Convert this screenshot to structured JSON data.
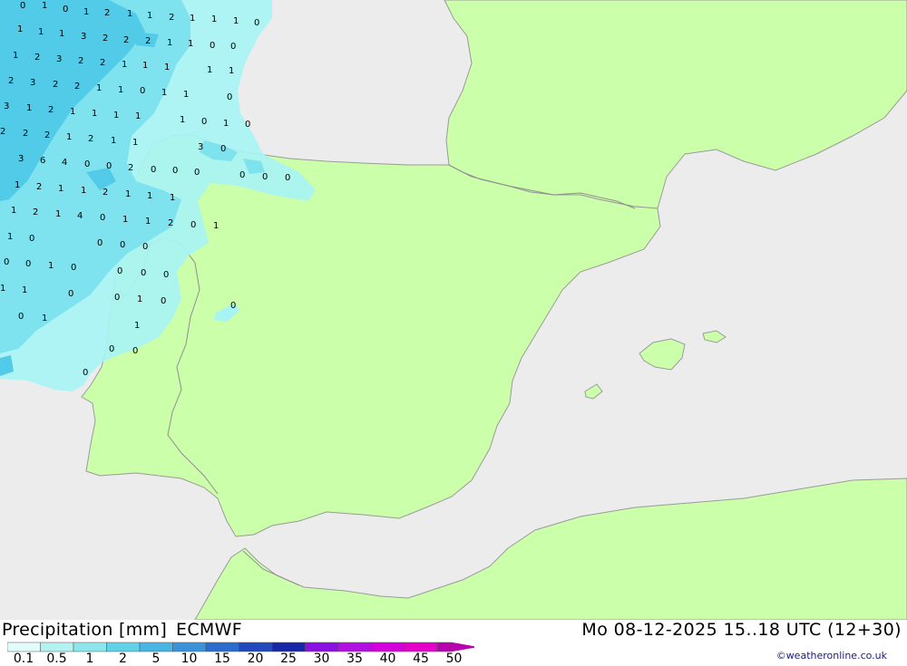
{
  "map": {
    "colors": {
      "sea": "#ececec",
      "land": "#ccffaa",
      "border": "#8f8f8f",
      "coast": "#9a9a9a"
    },
    "precip_colors": {
      "light": "#a8f4f4",
      "moderate": "#7ee3ef",
      "heavier": "#52cbe8"
    },
    "values": [
      "0",
      "1",
      "0",
      "1",
      "2",
      "1",
      "1",
      "2",
      "1",
      "1",
      "1",
      "0",
      "1",
      "1",
      "1",
      "3",
      "2",
      "2",
      "2",
      "1",
      "1",
      "0",
      "0",
      "1",
      "2",
      "3",
      "2",
      "2",
      "1",
      "1",
      "1",
      "1",
      "1",
      "2",
      "3",
      "2",
      "2",
      "1",
      "1",
      "0",
      "1",
      "1",
      "0",
      "3",
      "1",
      "2",
      "1",
      "1",
      "1",
      "1",
      "1",
      "0",
      "1",
      "0",
      "2",
      "2",
      "2",
      "1",
      "2",
      "1",
      "1",
      "3",
      "0",
      "3",
      "6",
      "4",
      "0",
      "0",
      "2",
      "0",
      "0",
      "0",
      "0",
      "0",
      "0",
      "1",
      "2",
      "1",
      "1",
      "2",
      "1",
      "1",
      "1",
      "1",
      "2",
      "1",
      "4",
      "0",
      "1",
      "1",
      "2",
      "0",
      "1",
      "1",
      "0",
      "0",
      "0",
      "0",
      "0",
      "0",
      "1",
      "0",
      "0",
      "0",
      "0",
      "1",
      "1",
      "0",
      "0",
      "1",
      "0",
      "0",
      "0",
      "1",
      "1",
      "0",
      "0",
      "0"
    ]
  },
  "footer": {
    "title": "Precipitation [mm]",
    "model": "ECMWF",
    "datetime": "Mo 08-12-2025 15..18 UTC (12+30)",
    "credit": "©weatheronline.co.uk",
    "legend": {
      "labels": [
        "0.1",
        "0.5",
        "1",
        "2",
        "5",
        "10",
        "15",
        "20",
        "25",
        "30",
        "35",
        "40",
        "45",
        "50"
      ],
      "colors": [
        "#e2fbfb",
        "#b4f2f2",
        "#8de6ec",
        "#62d2e8",
        "#4ab5e2",
        "#3a93d8",
        "#2c6ccd",
        "#2049be",
        "#1628a8",
        "#8a10e4",
        "#b010e0",
        "#d400dc",
        "#e400c8",
        "#b800b0"
      ]
    }
  }
}
